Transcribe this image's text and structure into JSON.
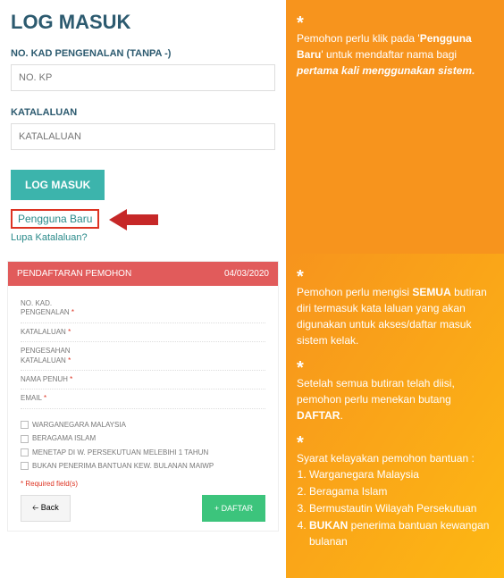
{
  "login": {
    "title": "LOG MASUK",
    "ic_label": "NO. KAD PENGENALAN (TANPA -)",
    "ic_placeholder": "NO. KP",
    "pw_label": "KATALALUAN",
    "pw_placeholder": "KATALALUAN",
    "login_btn": "LOG MASUK",
    "new_user": "Pengguna Baru",
    "forgot": "Lupa Katalaluan?"
  },
  "note1": {
    "pre": "Pemohon perlu klik pada '",
    "bold": "Pengguna Baru",
    "mid": "' untuk mendaftar nama bagi ",
    "italic": "pertama kali menggunakan sistem."
  },
  "reg": {
    "header_title": "PENDAFTARAN PEMOHON",
    "header_date": "04/03/2020",
    "fields": {
      "ic": "NO. KAD. PENGENALAN",
      "pw": "KATALALUAN",
      "pw2": "PENGESAHAN KATALALUAN",
      "name": "NAMA PENUH",
      "email": "EMAIL"
    },
    "checks": {
      "c1": "WARGANEGARA MALAYSIA",
      "c2": "BERAGAMA ISLAM",
      "c3": "MENETAP DI W. PERSEKUTUAN MELEBIHI 1 TAHUN",
      "c4": "BUKAN PENERIMA BANTUAN KEW. BULANAN MAIWP"
    },
    "required_text": "* Required field(s)",
    "back_btn": "🡠  Back",
    "daftar_btn": "+  DAFTAR"
  },
  "note2a": {
    "pre": "Pemohon perlu mengisi ",
    "bold": "SEMUA",
    "post": " butiran diri termasuk kata laluan yang akan digunakan untuk akses/daftar masuk sistem kelak."
  },
  "note2b": {
    "pre": "Setelah semua butiran telah diisi, pemohon perlu menekan butang ",
    "bold": "DAFTAR",
    "post": "."
  },
  "elig": {
    "title": "Syarat kelayakan pemohon bantuan :",
    "i1": "Warganegara Malaysia",
    "i2": "Beragama Islam",
    "i3": "Bermustautin Wilayah Persekutuan",
    "i4a": "BUKAN",
    "i4b": " penerima bantuan kewangan bulanan"
  }
}
